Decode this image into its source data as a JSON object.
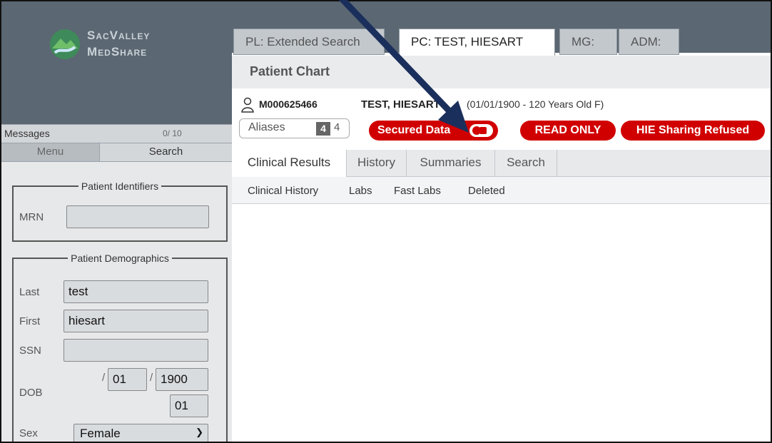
{
  "logo": {
    "line1": "SacValley",
    "line2": "MedShare"
  },
  "messages": {
    "label": "Messages",
    "count": "0/ 10"
  },
  "side_tabs": {
    "menu": "Menu",
    "search": "Search"
  },
  "patient_identifiers": {
    "legend": "Patient Identifiers",
    "mrn_label": "MRN",
    "mrn_value": ""
  },
  "demographics": {
    "legend": "Patient Demographics",
    "last_label": "Last",
    "last_value": "test",
    "first_label": "First",
    "first_value": "hiesart",
    "ssn_label": "SSN",
    "ssn_value": "",
    "dob_label": "DOB",
    "dob_day": "01",
    "dob_year": "1900",
    "dob_month": "01",
    "sex_label": "Sex",
    "sex_value": "Female"
  },
  "top_tabs": [
    "PL: Extended Search",
    "PC: TEST, HIESART",
    "MG:",
    "ADM:"
  ],
  "chart": {
    "title": "Patient Chart"
  },
  "patient": {
    "id": "M000625466",
    "name": "TEST, HIESART",
    "info": "(01/01/1900 - 120 Years Old F)",
    "aliases_label": "Aliases",
    "aliases_count_a": "4",
    "aliases_count_b": "4",
    "secured_label": "Secured Data",
    "read_only_label": "READ ONLY",
    "hie_label": "HIE Sharing Refused"
  },
  "sub_tabs": [
    "Clinical Results",
    "History",
    "Summaries",
    "Search"
  ],
  "links": [
    "Clinical History",
    "Labs",
    "Fast Labs",
    "Deleted"
  ],
  "colors": {
    "sidebar": "#5b6772",
    "alert_red": "#d10000",
    "arrow": "#1b2f5c"
  }
}
